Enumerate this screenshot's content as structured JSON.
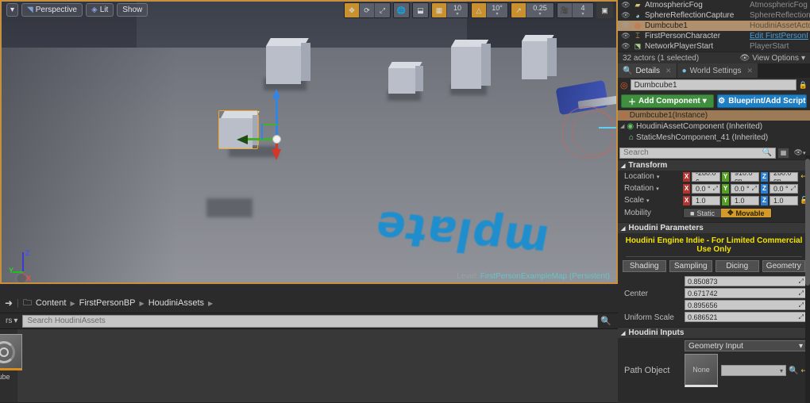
{
  "viewport": {
    "toolbar_left": [
      {
        "name": "viewport-menu",
        "label": "",
        "icon": "chevron-down-icon"
      },
      {
        "name": "perspective",
        "label": "Perspective",
        "icon": "camera-icon"
      },
      {
        "name": "lit",
        "label": "Lit",
        "icon": "cube-icon"
      },
      {
        "name": "show",
        "label": "Show",
        "icon": ""
      }
    ],
    "toolbar_right": {
      "transform_tools": [
        "translate-icon",
        "rotate-icon",
        "scale-icon"
      ],
      "coord_system": "globe-icon",
      "surface_snap": "surface-snap-icon",
      "grid_snap_on": true,
      "grid_snap_value": "10",
      "angle_snap_value": "10°",
      "scale_snap_value": "0.25",
      "camera_speed_value": "4",
      "maximize": "maximize-icon"
    },
    "floor_text": "mplate",
    "level_prefix": "Level:",
    "level_name": "FirstPersonExampleMap (Persistent)",
    "axis_labels": {
      "x": "X",
      "y": "Y",
      "z": "Z"
    }
  },
  "content_browser": {
    "breadcrumb": [
      "Content",
      "FirstPersonBP",
      "HoudiniAssets"
    ],
    "folder_icon": "folder-icon",
    "filters_label": "rs",
    "search_placeholder": "Search HoudiniAssets",
    "asset_label": "ube"
  },
  "outliner": {
    "rows": [
      {
        "name": "AtmosphericFog",
        "type": "AtmosphericFog",
        "icon": "fog-icon",
        "selected": false,
        "link": false
      },
      {
        "name": "SphereReflectionCapture",
        "type": "SphereReflectionC",
        "icon": "sphere-icon",
        "selected": false,
        "link": false
      },
      {
        "name": "Dumbcube1",
        "type": "HoudiniAssetActo",
        "icon": "houdini-icon",
        "selected": true,
        "link": false
      },
      {
        "name": "FirstPersonCharacter",
        "type": "Edit FirstPersonI",
        "icon": "character-icon",
        "selected": false,
        "link": true
      },
      {
        "name": "NetworkPlayerStart",
        "type": "PlayerStart",
        "icon": "playerstart-icon",
        "selected": false,
        "link": false
      }
    ],
    "footer_count": "32 actors (1 selected)",
    "view_options": "View Options"
  },
  "details": {
    "tabs": [
      {
        "label": "Details",
        "icon": "magnifier-icon",
        "active": true
      },
      {
        "label": "World Settings",
        "icon": "globe-icon",
        "active": false
      }
    ],
    "actor_name": "Dumbcube1",
    "actor_icon": "houdini-icon",
    "lock_icon": "lock-icon",
    "add_component_label": "Add Component",
    "blueprint_label": "Blueprint/Add Script",
    "components": [
      {
        "label": "Dumbcube1(Instance)",
        "icon": "houdini-icon",
        "selected": true,
        "indent": 0
      },
      {
        "label": "HoudiniAssetComponent (Inherited)",
        "icon": "component-icon",
        "selected": false,
        "indent": 0
      },
      {
        "label": "StaticMeshComponent_41 (Inherited)",
        "icon": "mesh-icon",
        "selected": false,
        "indent": 1
      }
    ],
    "search_placeholder": "Search",
    "search_icon": "magnifier-icon",
    "grid_icon": "grid-icon",
    "eye_icon": "eye-icon",
    "transform": {
      "title": "Transform",
      "location_label": "Location",
      "rotation_label": "Rotation",
      "scale_label": "Scale",
      "mobility_label": "Mobility",
      "location": [
        "-280.0 c",
        "910.0 cn",
        "260.0 cn"
      ],
      "rotation": [
        "0.0 °",
        "0.0 °",
        "0.0 °"
      ],
      "scale": [
        "1.0",
        "1.0",
        "1.0"
      ],
      "mobility_static": "Static",
      "mobility_movable": "Movable",
      "mobility_selected": "Movable",
      "axes": [
        "X",
        "Y",
        "Z"
      ]
    },
    "houdini_parameters": {
      "title": "Houdini Parameters",
      "license_banner": "Houdini Engine Indie - For Limited Commercial Use Only",
      "tabs": [
        "Shading",
        "Sampling",
        "Dicing",
        "Geometry"
      ],
      "center_label": "Center",
      "center_values": [
        "0.850873",
        "0.671742",
        "0.895656"
      ],
      "uniform_scale_label": "Uniform Scale",
      "uniform_scale_value": "0.686521"
    },
    "houdini_inputs": {
      "title": "Houdini Inputs",
      "input_type": "Geometry Input",
      "path_object_label": "Path Object",
      "thumb_label": "None"
    }
  },
  "colors": {
    "accent_orange": "#c8902f",
    "selection_tan": "#b08f6c",
    "green_button": "#3f8f3f",
    "blue_button": "#1f7fc4",
    "license_yellow": "#f2e300",
    "link_blue": "#4c9ed9",
    "floor_text_blue": "#1b8fd0"
  }
}
